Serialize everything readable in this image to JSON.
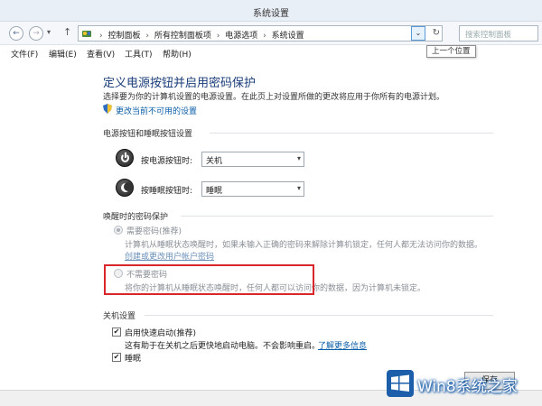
{
  "window": {
    "title": "系统设置"
  },
  "nav": {
    "back": "←",
    "forward": "→",
    "dropdown": "▾",
    "up": "↑",
    "breadcrumb": [
      "控制面板",
      "所有控制面板项",
      "电源选项",
      "系统设置"
    ],
    "breadcrumb_sep": "›",
    "address_drop": "⌄",
    "refresh": "↻",
    "search_placeholder": "搜索控制面板",
    "tooltip": "上一个位置"
  },
  "menubar": [
    {
      "label": "文件(F)"
    },
    {
      "label": "编辑(E)"
    },
    {
      "label": "查看(V)"
    },
    {
      "label": "工具(T)"
    },
    {
      "label": "帮助(H)"
    }
  ],
  "page": {
    "heading": "定义电源按钮并启用密码保护",
    "description": "选择要为你的计算机设置的电源设置。在此页上对设置所做的更改将应用于你所有的电源计划。",
    "change_link": "更改当前不可用的设置"
  },
  "power_buttons": {
    "section_title": "电源按钮和睡眠按钮设置",
    "power_label": "按电源按钮时:",
    "power_value": "关机",
    "sleep_label": "按睡眠按钮时:",
    "sleep_value": "睡眠",
    "select_arrow": "▾"
  },
  "password": {
    "section_title": "唤醒时的密码保护",
    "require_label": "需要密码(推荐)",
    "require_desc": "计算机从睡眠状态唤醒时，如果未输入正确的密码来解除计算机锁定，任何人都无法访问你的数据。",
    "require_link": "创建或更改用户帐户密码",
    "norequire_label": "不需要密码",
    "norequire_desc": "将你的计算机从睡眠状态唤醒时，任何人都可以访问你的数据，因为计算机未锁定。"
  },
  "shutdown": {
    "section_title": "关机设置",
    "fast_startup_label": "启用快速启动(推荐)",
    "fast_startup_desc": "这有助于在关机之后更快地启动电脑。不会影响重启。",
    "learn_more": "了解更多信息",
    "sleep_label": "睡眠",
    "checkmark": "✔"
  },
  "footer": {
    "save_label": "保存"
  },
  "watermark": {
    "text": "Win8系统之家"
  },
  "colors": {
    "heading": "#1a3d7a",
    "link": "#0b5ea8",
    "highlight": "#d8262a",
    "watermark_blue": "#1c5ea9"
  }
}
